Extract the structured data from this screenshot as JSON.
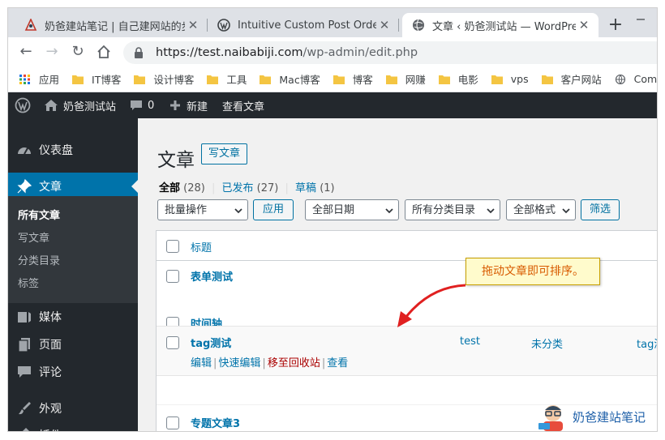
{
  "browser": {
    "tabs": [
      {
        "title": "奶爸建站笔记 | 自己建网站的步骤",
        "active": false
      },
      {
        "title": "Intuitive Custom Post Order –",
        "active": false
      },
      {
        "title": "文章 ‹ 奶爸测试站 — WordPress",
        "active": true
      }
    ],
    "new_tab": "+",
    "url_host": "https://test.naibabiji.com",
    "url_path": "/wp-admin/edit.php",
    "bookmarks": [
      "应用",
      "IT博客",
      "设计博客",
      "工具",
      "Mac博客",
      "博客",
      "网赚",
      "电影",
      "vps",
      "客户网站",
      "Compr"
    ]
  },
  "adminbar": {
    "site_name": "奶爸测试站",
    "comments_count": "0",
    "new_label": "新建",
    "view_posts": "查看文章"
  },
  "sidebar": {
    "dashboard": "仪表盘",
    "posts": "文章",
    "sub": [
      "所有文章",
      "写文章",
      "分类目录",
      "标签"
    ],
    "media": "媒体",
    "pages": "页面",
    "comments": "评论",
    "appearance": "外观",
    "plugins": "插件"
  },
  "main": {
    "title": "文章",
    "add_new": "写文章",
    "filters": {
      "all": "全部",
      "all_count": "(28)",
      "published": "已发布",
      "published_count": "(27)",
      "drafts": "草稿",
      "drafts_count": "(1)",
      "sep": "|"
    },
    "bulk_action": "批量操作",
    "apply": "应用",
    "all_dates": "全部日期",
    "all_categories": "所有分类目录",
    "all_formats": "全部格式",
    "filter_btn": "筛选",
    "column_title": "标题",
    "rows": [
      {
        "title": "表单测试"
      },
      {
        "title": "时间轴"
      },
      {
        "title": "tag测试",
        "author": "test",
        "category": "未分类",
        "tags": "tag测"
      },
      {
        "title": "专题文章3"
      }
    ],
    "row_actions": {
      "edit": "编辑",
      "quick_edit": "快速编辑",
      "trash": "移至回收站",
      "view": "查看",
      "sep": "|"
    }
  },
  "annotation": {
    "callout": "拖动文章即可排序。",
    "watermark": "奶爸建站笔记"
  },
  "colors": {
    "wp_blue": "#0073aa",
    "admin_dark": "#23282d",
    "arrow_red": "#e02020",
    "callout_text": "#d85b00"
  }
}
